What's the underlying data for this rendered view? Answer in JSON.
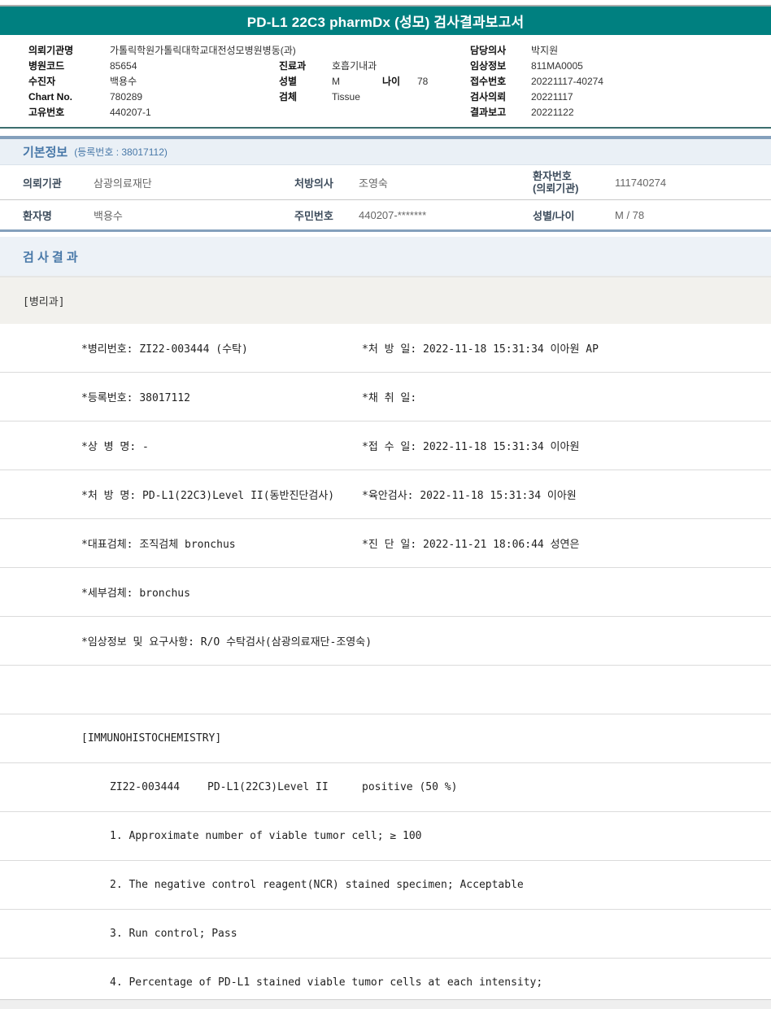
{
  "title": "PD-L1 22C3 pharmDx (성모) 검사결과보고서",
  "header": {
    "rows": [
      {
        "l1": "의뢰기관명",
        "v1": "가톨릭학원가톨릭대학교대전성모병원병동(과)",
        "l3": "담당의사",
        "v3": "박지원"
      },
      {
        "l1": "병원코드",
        "v1": "85654",
        "l2": "진료과",
        "v2": "호흡기내과",
        "l3": "임상정보",
        "v3": "811MA0005"
      },
      {
        "l1": "수진자",
        "v1": "백용수",
        "l2": "성별",
        "v2": "M",
        "l2b": "나이",
        "v2b": "78",
        "l3": "접수번호",
        "v3": "20221117-40274"
      },
      {
        "l1": "Chart No.",
        "v1": "780289",
        "l2": "검체",
        "v2": "Tissue",
        "l3": "검사의뢰",
        "v3": "20221117"
      },
      {
        "l1": "고유번호",
        "v1": "440207-1",
        "l3": "결과보고",
        "v3": "20221122"
      }
    ]
  },
  "basic_info": {
    "title": "기본정보",
    "subtitle": "(등록번호 : 38017112)",
    "rows": [
      {
        "l1": "의뢰기관",
        "v1": "삼광의료재단",
        "l2": "처방의사",
        "v2": "조영숙",
        "l3a": "환자번호",
        "l3b": "(의뢰기관)",
        "v3": "111740274"
      },
      {
        "l1": "환자명",
        "v1": "백용수",
        "l2": "주민번호",
        "v2": "440207-*******",
        "l3a": "성별/나이",
        "l3b": "",
        "v3": "M / 78"
      }
    ]
  },
  "results": {
    "title": "검 사 결 과",
    "department": "[병리과]",
    "detail_rows": [
      {
        "left": "*병리번호: ZI22-003444 (수탁)",
        "right": "*처 방 일: 2022-11-18 15:31:34  이아원 AP"
      },
      {
        "left": "*등록번호: 38017112",
        "right": "*채 취 일:"
      },
      {
        "left": "*상 병 명: -",
        "right": "*접 수 일: 2022-11-18 15:31:34  이아원"
      },
      {
        "left": "*처 방 명: PD-L1(22C3)Level II(동반진단검사)",
        "right": "*육안검사: 2022-11-18 15:31:34  이아원"
      },
      {
        "left": "*대표검체: 조직검체 bronchus",
        "right": "*진 단 일: 2022-11-21 18:06:44  성연은"
      },
      {
        "left": "*세부검체: bronchus",
        "right": ""
      },
      {
        "left": "*임상정보 및 요구사항: R/O 수탁검사(삼광의료재단-조영숙)",
        "right": ""
      }
    ],
    "ihc": {
      "section_label": "[IMMUNOHISTOCHEMISTRY]",
      "specimen_no": "ZI22-003444",
      "test_name": "PD-L1(22C3)Level II",
      "result": "positive (50 %)",
      "notes": [
        "1. Approximate number of viable tumor cell; ≥ 100",
        "2. The negative control reagent(NCR) stained specimen; Acceptable",
        "3. Run control; Pass",
        "4. Percentage of PD-L1 stained viable tumor cells at each intensity;"
      ]
    }
  }
}
